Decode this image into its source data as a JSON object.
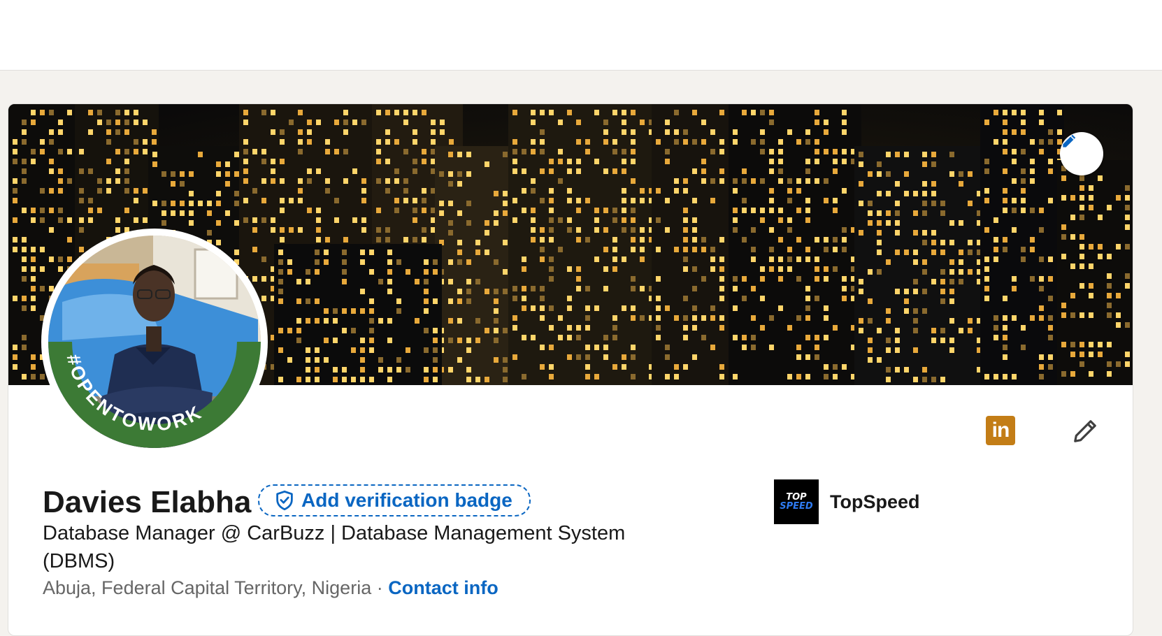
{
  "profile": {
    "name": "Davies Elabha",
    "verification_label": "Add verification badge",
    "headline": "Database Manager @ CarBuzz | Database Management System (DBMS)",
    "location": "Abuja, Federal Capital Territory, Nigeria",
    "separator": "·",
    "contact_label": "Contact info",
    "open_to_work_frame": "#OPENTOWORK"
  },
  "company": {
    "name": "TopSpeed",
    "logo_line1": "TOP",
    "logo_line2": "SPEED"
  },
  "icons": {
    "cover_edit": "pencil-icon",
    "brand": "linkedin-icon",
    "brand_text": "in",
    "profile_edit": "pencil-icon",
    "verify": "shield-check-icon"
  },
  "colors": {
    "accent": "#0a66c2",
    "open_to_work": "#3c7a35",
    "brand_icon": "#c37d16"
  }
}
